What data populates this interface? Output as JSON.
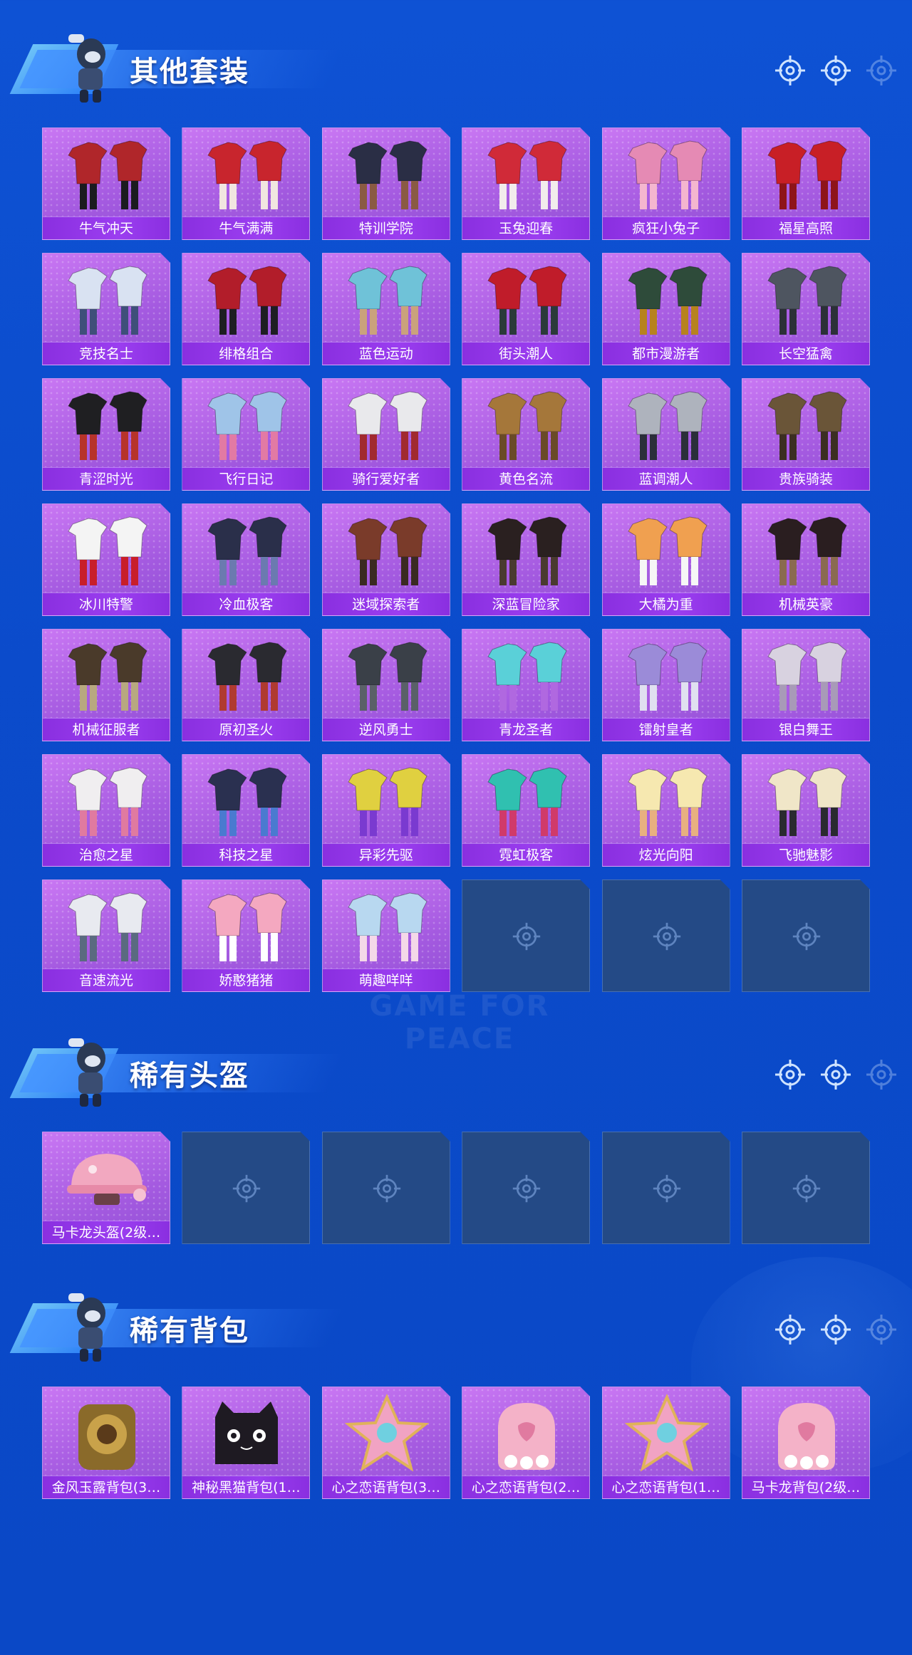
{
  "sections": [
    {
      "title": "其他套装",
      "items": [
        {
          "label": "牛气冲天",
          "art": "outfit"
        },
        {
          "label": "牛气满满",
          "art": "outfit"
        },
        {
          "label": "特训学院",
          "art": "outfit"
        },
        {
          "label": "玉兔迎春",
          "art": "outfit"
        },
        {
          "label": "疯狂小兔子",
          "art": "outfit"
        },
        {
          "label": "福星高照",
          "art": "outfit"
        },
        {
          "label": "竞技名士",
          "art": "outfit"
        },
        {
          "label": "绯格组合",
          "art": "outfit"
        },
        {
          "label": "蓝色运动",
          "art": "outfit"
        },
        {
          "label": "街头潮人",
          "art": "outfit"
        },
        {
          "label": "都市漫游者",
          "art": "outfit"
        },
        {
          "label": "长空猛禽",
          "art": "outfit"
        },
        {
          "label": "青涩时光",
          "art": "outfit"
        },
        {
          "label": "飞行日记",
          "art": "outfit"
        },
        {
          "label": "骑行爱好者",
          "art": "outfit"
        },
        {
          "label": "黄色名流",
          "art": "outfit"
        },
        {
          "label": "蓝调潮人",
          "art": "outfit"
        },
        {
          "label": "贵族骑装",
          "art": "outfit"
        },
        {
          "label": "冰川特警",
          "art": "outfit"
        },
        {
          "label": "冷血极客",
          "art": "outfit"
        },
        {
          "label": "迷域探索者",
          "art": "outfit"
        },
        {
          "label": "深蓝冒险家",
          "art": "outfit"
        },
        {
          "label": "大橘为重",
          "art": "outfit"
        },
        {
          "label": "机械英豪",
          "art": "outfit"
        },
        {
          "label": "机械征服者",
          "art": "outfit"
        },
        {
          "label": "原初圣火",
          "art": "outfit"
        },
        {
          "label": "逆风勇士",
          "art": "outfit"
        },
        {
          "label": "青龙圣者",
          "art": "outfit"
        },
        {
          "label": "镭射皇者",
          "art": "outfit"
        },
        {
          "label": "银白舞王",
          "art": "outfit"
        },
        {
          "label": "治愈之星",
          "art": "outfit"
        },
        {
          "label": "科技之星",
          "art": "outfit"
        },
        {
          "label": "异彩先驱",
          "art": "outfit"
        },
        {
          "label": "霓虹极客",
          "art": "outfit"
        },
        {
          "label": "炫光向阳",
          "art": "outfit"
        },
        {
          "label": "飞驰魅影",
          "art": "outfit"
        },
        {
          "label": "音速流光",
          "art": "outfit"
        },
        {
          "label": "娇憨猪猪",
          "art": "outfit"
        },
        {
          "label": "萌趣咩咩",
          "art": "outfit"
        }
      ],
      "empty_slots": 3
    },
    {
      "title": "稀有头盔",
      "items": [
        {
          "label": "马卡龙头盔(2级…",
          "art": "helmet"
        }
      ],
      "empty_slots": 5
    },
    {
      "title": "稀有背包",
      "items": [
        {
          "label": "金风玉露背包(3…",
          "art": "bag-gold"
        },
        {
          "label": "神秘黑猫背包(1…",
          "art": "bag-cat"
        },
        {
          "label": "心之恋语背包(3…",
          "art": "bag-star"
        },
        {
          "label": "心之恋语背包(2…",
          "art": "bag-pink"
        },
        {
          "label": "心之恋语背包(1…",
          "art": "bag-star"
        },
        {
          "label": "马卡龙背包(2级…",
          "art": "bag-pink"
        }
      ],
      "empty_slots": 0
    }
  ],
  "watermark": "GAME FOR PEACE",
  "icons": {
    "header": "target-icon",
    "slot": "target-icon",
    "mascot": "mascot-icon"
  },
  "colors": {
    "background": "#0b4bcb",
    "card": "#b568ea",
    "label_bar": "#8f35e8",
    "empty": "#244a86"
  }
}
